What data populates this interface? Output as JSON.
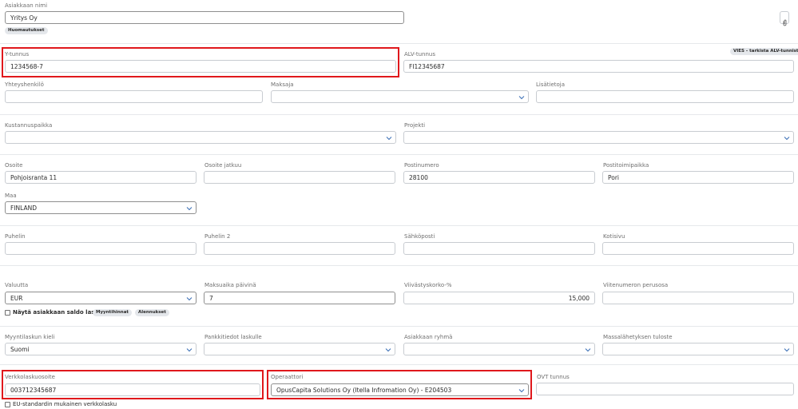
{
  "customer": {
    "name_label": "Asiakkaan nimi",
    "name_value": "Yritys Oy",
    "notes_button": "Huomautukset",
    "attachment_icon": "paperclip-icon"
  },
  "tax": {
    "ytunnus_label": "Y-tunnus",
    "ytunnus_value": "1234568-7",
    "alv_label": "ALV-tunnus",
    "alv_value": "FI12345687",
    "vies_button": "VIES - tarkista ALV-tunniste"
  },
  "contact": {
    "contact_person_label": "Yhteyshenkilö",
    "contact_person_value": "",
    "payer_label": "Maksaja",
    "payer_value": "",
    "extra_label": "Lisätietoja",
    "extra_value": ""
  },
  "cost": {
    "cost_center_label": "Kustannuspaikka",
    "cost_center_value": "",
    "project_label": "Projekti",
    "project_value": ""
  },
  "address": {
    "street_label": "Osoite",
    "street_value": "Pohjoisranta 11",
    "street2_label": "Osoite jatkuu",
    "street2_value": "",
    "postcode_label": "Postinumero",
    "postcode_value": "28100",
    "city_label": "Postitoimipaikka",
    "city_value": "Pori",
    "country_label": "Maa",
    "country_value": "FINLAND"
  },
  "phones": {
    "phone_label": "Puhelin",
    "phone_value": "",
    "phone2_label": "Puhelin 2",
    "phone2_value": "",
    "email_label": "Sähköposti",
    "email_value": "",
    "homepage_label": "Kotisivu",
    "homepage_value": ""
  },
  "payment": {
    "currency_label": "Valuutta",
    "currency_value": "EUR",
    "due_days_label": "Maksuaika päivinä",
    "due_days_value": "7",
    "late_interest_label": "Viivästyskorko-%",
    "late_interest_value": "15,000",
    "reference_basis_label": "Viitenumeron perusosa",
    "reference_basis_value": "",
    "show_balance_label": "Näytä asiakkaan saldo laskulla",
    "show_balance_checked": false,
    "sales_prices_button": "Myyntihinnat",
    "discounts_button": "Alennukset"
  },
  "invoice": {
    "language_label": "Myyntilaskun kieli",
    "language_value": "Suomi",
    "bank_label": "Pankkitiedot laskulle",
    "bank_value": "",
    "group_label": "Asiakkaan ryhmä",
    "group_value": "",
    "mass_print_label": "Massalähetyksen tuloste",
    "mass_print_value": ""
  },
  "einvoice": {
    "address_label": "Verkkolaskuosoite",
    "address_value": "003712345687",
    "operator_label": "Operaattori",
    "operator_value": "OpusCapita Solutions Oy (Itella Infromation Oy) - E204503",
    "ovt_label": "OVT tunnus",
    "ovt_value": "",
    "eu_standard_label": "EU-standardin mukainen verkkolasku",
    "eu_standard_checked": false
  },
  "colors": {
    "highlight": "#e0181c",
    "chevron": "#3b6fb6",
    "pill_bg": "#e4e7eb"
  }
}
